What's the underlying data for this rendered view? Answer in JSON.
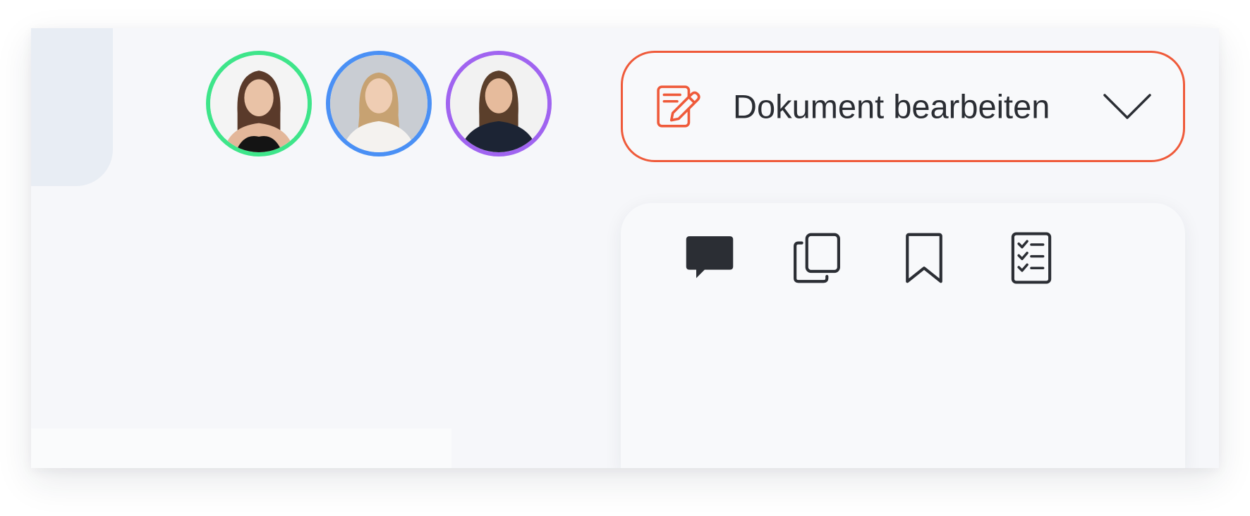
{
  "toolbar": {
    "mode_label": "Dokument bearbeiten"
  },
  "collaborators": [
    {
      "ring_color": "#3ee58a"
    },
    {
      "ring_color": "#4a90f5"
    },
    {
      "ring_color": "#a064f0"
    }
  ],
  "side_panel": {
    "tools": [
      {
        "icon": "comment-icon",
        "active": true
      },
      {
        "icon": "copy-icon",
        "active": false
      },
      {
        "icon": "bookmark-icon",
        "active": false
      },
      {
        "icon": "checklist-icon",
        "active": false
      }
    ]
  },
  "colors": {
    "accent": "#ef5a3a",
    "icon_dark": "#2b2e34",
    "background": "#f6f7fa"
  }
}
